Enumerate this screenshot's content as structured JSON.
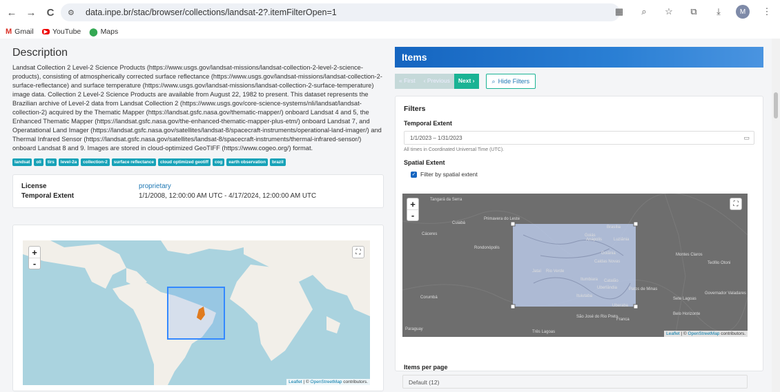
{
  "browser": {
    "url": "data.inpe.br/stac/browser/collections/landsat-2?.itemFilterOpen=1",
    "back_icon": "←",
    "forward_icon": "→",
    "reload_icon": "C",
    "avatar_initial": "M"
  },
  "bookmarks": [
    {
      "label": "Gmail",
      "icon": "gmail-icon"
    },
    {
      "label": "YouTube",
      "icon": "youtube-icon"
    },
    {
      "label": "Maps",
      "icon": "maps-icon"
    }
  ],
  "description": {
    "title": "Description",
    "text": "Landsat Collection 2 Level-2 Science Products (https://www.usgs.gov/landsat-missions/landsat-collection-2-level-2-science-products), consisting of atmospherically corrected surface reflectance (https://www.usgs.gov/landsat-missions/landsat-collection-2-surface-reflectance) and surface temperature (https://www.usgs.gov/landsat-missions/landsat-collection-2-surface-temperature) image data. Collection 2 Level-2 Science Products are available from August 22, 1982 to present. This dataset represents the Brazilian archive of Level-2 data from Landsat Collection 2 (https://www.usgs.gov/core-science-systems/nli/landsat/landsat-collection-2) acquired by the Thematic Mapper (https://landsat.gsfc.nasa.gov/thematic-mapper/) onboard Landsat 4 and 5, the Enhanced Thematic Mapper (https://landsat.gsfc.nasa.gov/the-enhanced-thematic-mapper-plus-etm/) onboard Landsat 7, and Operatational Land Imager (https://landsat.gsfc.nasa.gov/satellites/landsat-8/spacecraft-instruments/operational-land-imager/) and Thermal Infrared Sensor (https://landsat.gsfc.nasa.gov/satellites/landsat-8/spacecraft-instruments/thermal-infrared-sensor/) onboard Landsat 8 and 9. Images are stored in cloud-optimized GeoTIFF (https://www.cogeo.org/) format.",
    "tags": [
      "landsat",
      "oli",
      "tirs",
      "level-2a",
      "collection-2",
      "surface reflectance",
      "cloud optimized geotiff",
      "cog",
      "earth observation",
      "brazil"
    ]
  },
  "metadata": {
    "license_label": "License",
    "license_value": "proprietary",
    "temporal_label": "Temporal Extent",
    "temporal_value": "1/1/2008, 12:00:00 AM UTC - 4/17/2024, 12:00:00 AM UTC"
  },
  "map_attribution": {
    "leaflet": "Leaflet",
    "sep": " | © ",
    "osm": "OpenStreetMap",
    "suffix": " contributors."
  },
  "items": {
    "title": "Items",
    "first": "« First",
    "previous": "‹ Previous",
    "next": "Next ›",
    "hide_filters": "Hide Filters"
  },
  "filters": {
    "title": "Filters",
    "temporal_label": "Temporal Extent",
    "date_value": "1/1/2023 – 1/31/2023",
    "date_hint": "All times in Coordinated Universal Time (UTC).",
    "spatial_label": "Spatial Extent",
    "spatial_checkbox": "Filter by spatial extent",
    "spatial_checked": true
  },
  "map_labels": [
    "Tangará da Serra",
    "Cuiabá",
    "Primavera do Leste",
    "Cáceres",
    "Brasília",
    "Goiás",
    "Anápolis",
    "Luziânia",
    "Rondonópolis",
    "Goiânia",
    "Caldas Novas",
    "Jataí",
    "Rio Verde",
    "Itumbiara",
    "Catalão",
    "Uberlândia",
    "Patos de Minas",
    "Montes Claros",
    "Teófilo Otoni",
    "Ituiutaba",
    "Corumbá",
    "Sete Lagoas",
    "Governador Valadares",
    "Uberaba",
    "Belo Horizonte",
    "São José do Rio Preto",
    "Franca",
    "Três Lagoas",
    "Paraguay"
  ],
  "per_page": {
    "label": "Items per page",
    "value": "Default (12)"
  }
}
